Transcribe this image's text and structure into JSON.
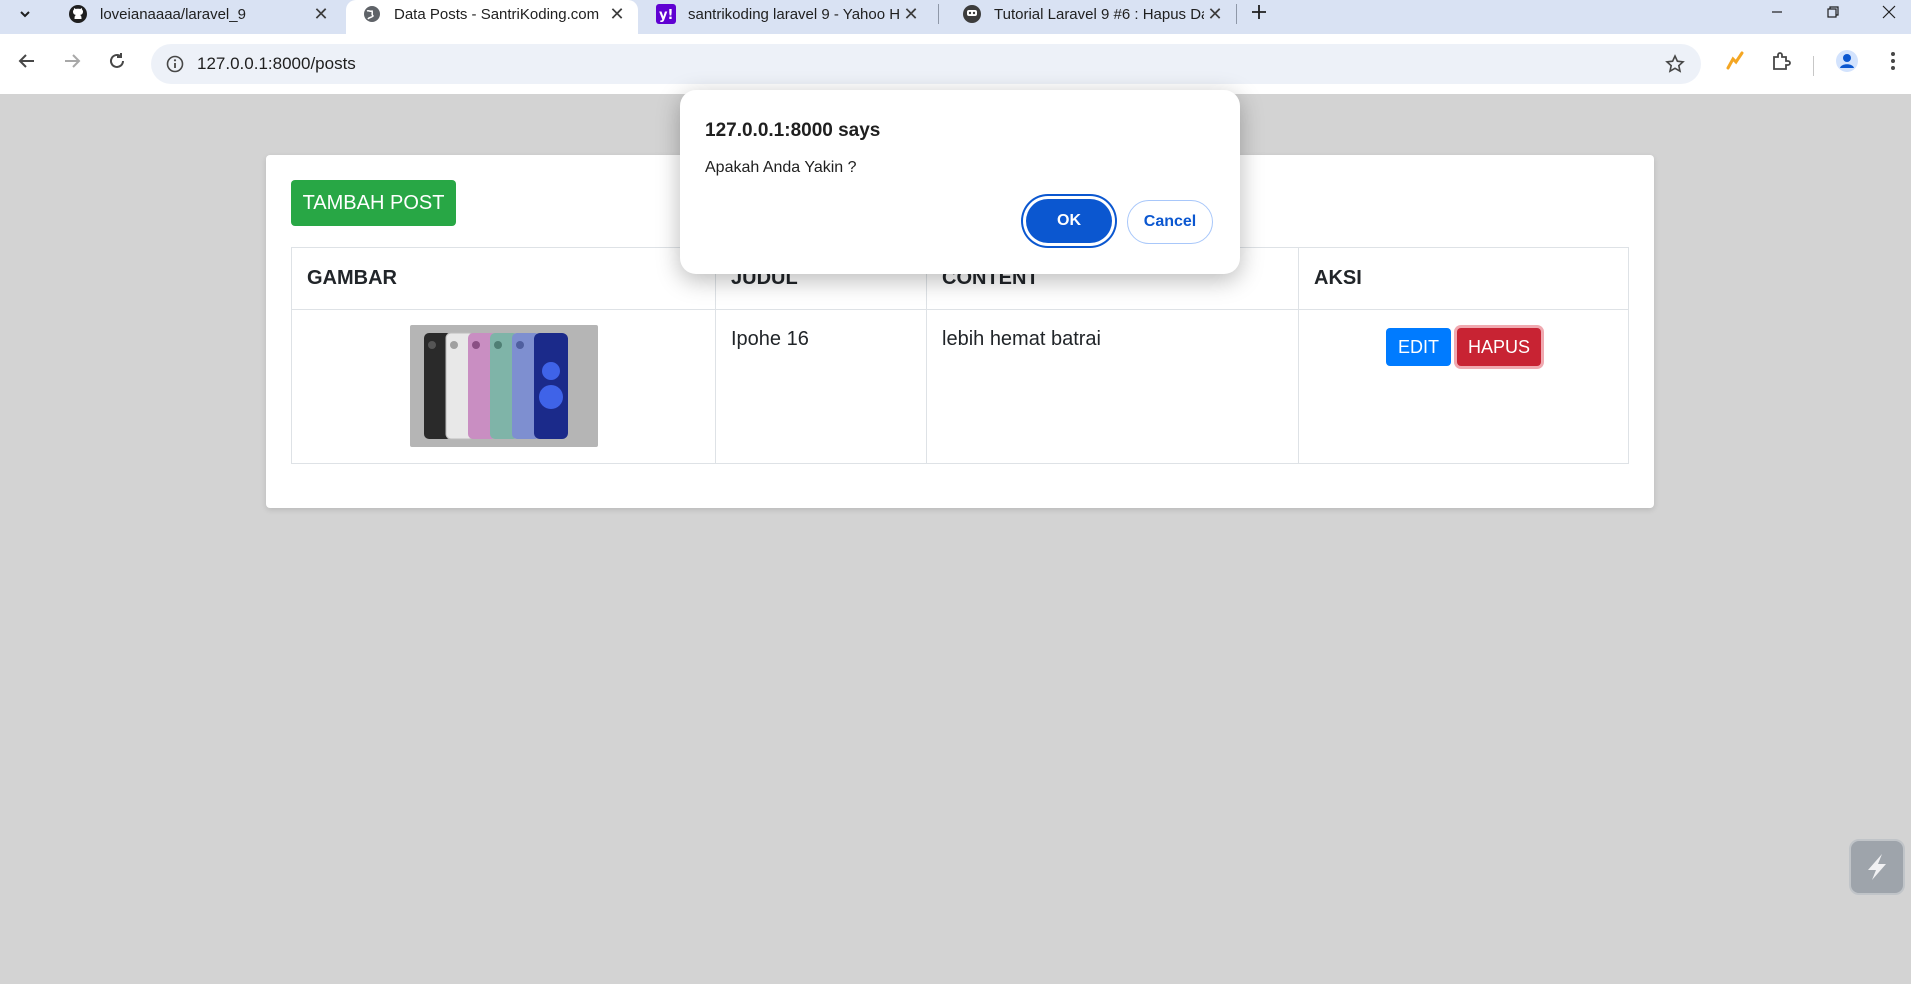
{
  "browser": {
    "tabs": [
      {
        "title": "loveianaaaa/laravel_9",
        "icon": "github-icon",
        "active": false
      },
      {
        "title": "Data Posts - SantriKoding.com",
        "icon": "globe-icon",
        "active": true
      },
      {
        "title": "santrikoding laravel 9 - Yahoo H",
        "icon": "yahoo-icon",
        "active": false
      },
      {
        "title": "Tutorial Laravel 9 #6 : Hapus Da",
        "icon": "site-icon",
        "active": false
      }
    ],
    "url": "127.0.0.1:8000/posts"
  },
  "page": {
    "add_button": "TAMBAH POST",
    "table": {
      "headers": [
        "GAMBAR",
        "JUDUL",
        "CONTENT",
        "AKSI"
      ],
      "rows": [
        {
          "judul": "Ipohe 16",
          "content": "lebih hemat batrai",
          "edit_label": "EDIT",
          "delete_label": "HAPUS"
        }
      ]
    }
  },
  "dialog": {
    "title": "127.0.0.1:8000 says",
    "message": "Apakah Anda Yakin ?",
    "ok_label": "OK",
    "cancel_label": "Cancel"
  },
  "colors": {
    "success": "#28a745",
    "primary": "#007bff",
    "danger": "#c82333",
    "dialog_accent": "#0b57d0"
  }
}
